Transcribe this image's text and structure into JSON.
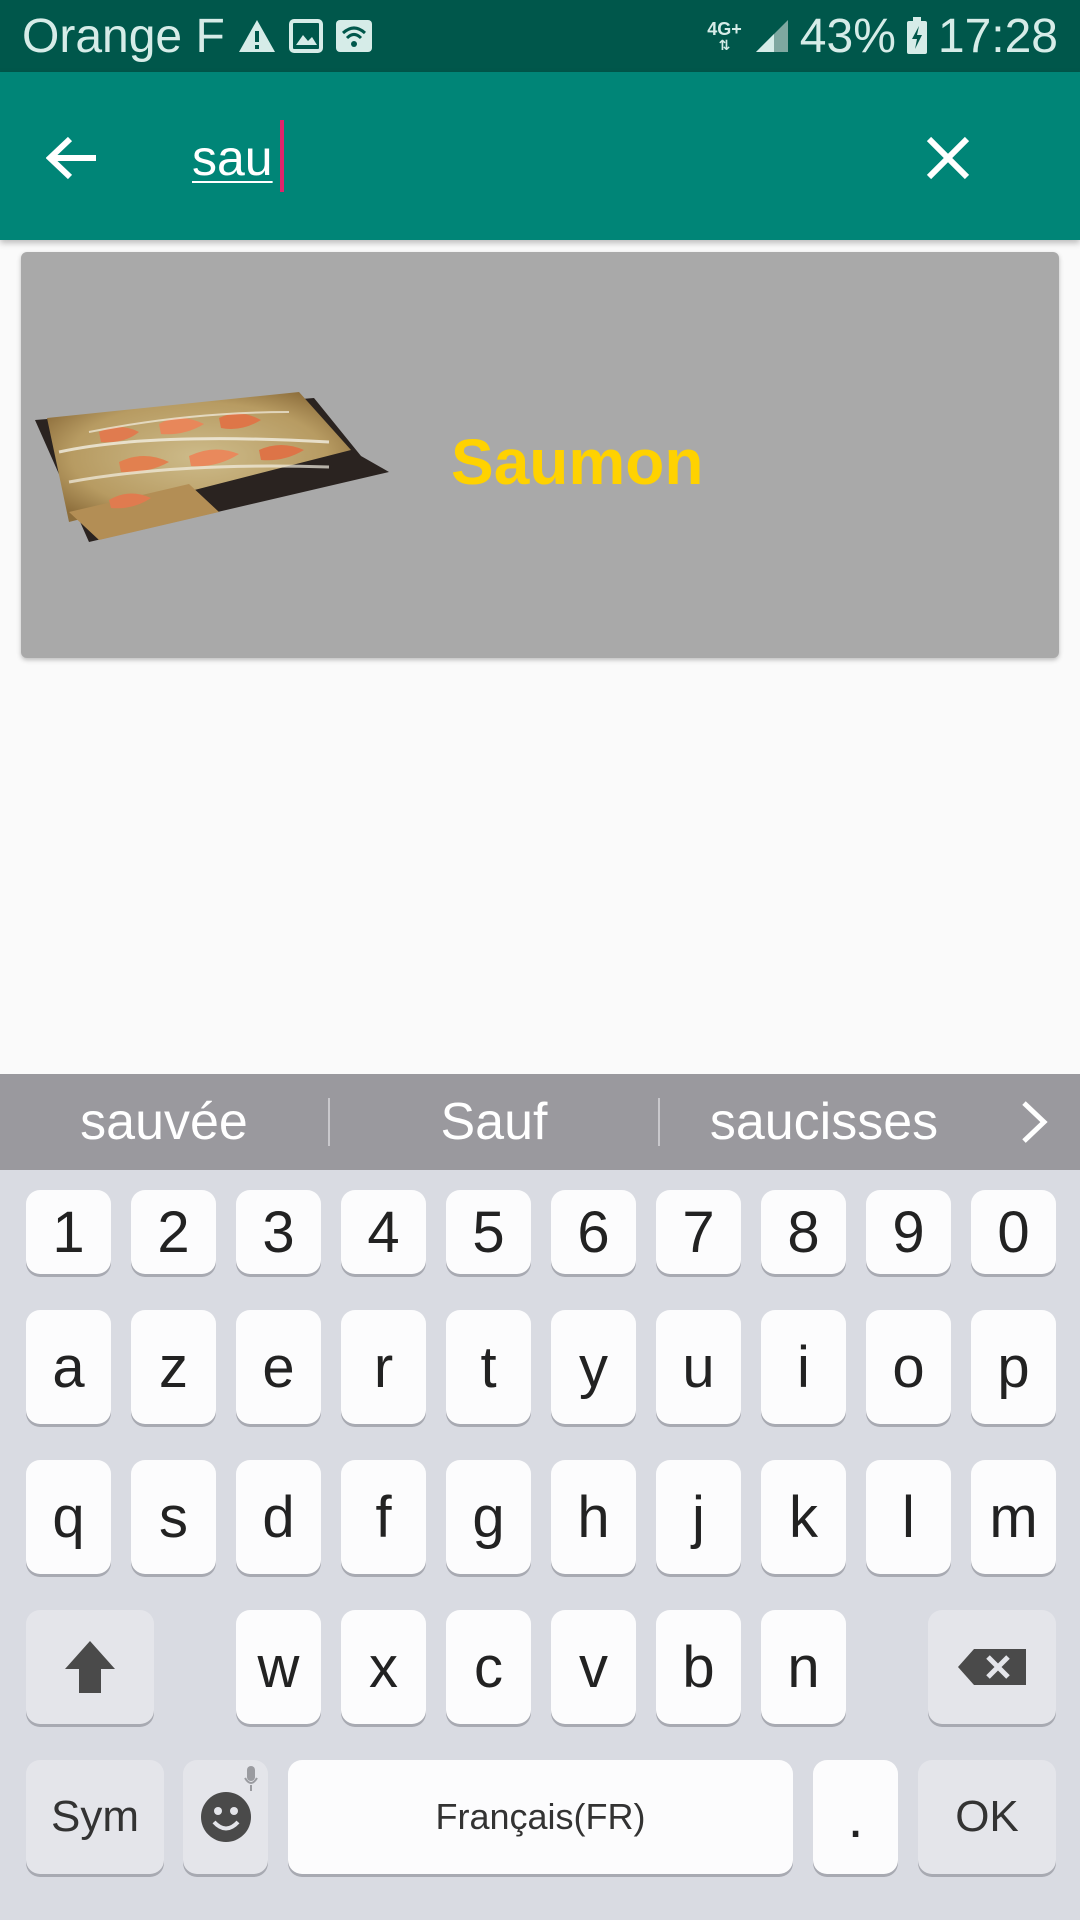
{
  "status_bar": {
    "carrier": "Orange F",
    "network": "4G+",
    "battery": "43%",
    "time": "17:28"
  },
  "search": {
    "query": "sau"
  },
  "results": [
    {
      "title": "Saumon"
    }
  ],
  "keyboard": {
    "suggestions": [
      "sauvée",
      "Sauf",
      "saucisses"
    ],
    "row_numbers": [
      "1",
      "2",
      "3",
      "4",
      "5",
      "6",
      "7",
      "8",
      "9",
      "0"
    ],
    "row_1": [
      "a",
      "z",
      "e",
      "r",
      "t",
      "y",
      "u",
      "i",
      "o",
      "p"
    ],
    "row_2": [
      "q",
      "s",
      "d",
      "f",
      "g",
      "h",
      "j",
      "k",
      "l",
      "m"
    ],
    "row_3": [
      "w",
      "x",
      "c",
      "v",
      "b",
      "n"
    ],
    "sym_label": "Sym",
    "space_label": "Français(FR)",
    "period_label": ".",
    "ok_label": "OK"
  },
  "colors": {
    "status_bar": "#00574b",
    "app_bar": "#008577",
    "card_background": "#a9a9a9",
    "card_title": "#ffd200",
    "caret": "#e0246b"
  }
}
